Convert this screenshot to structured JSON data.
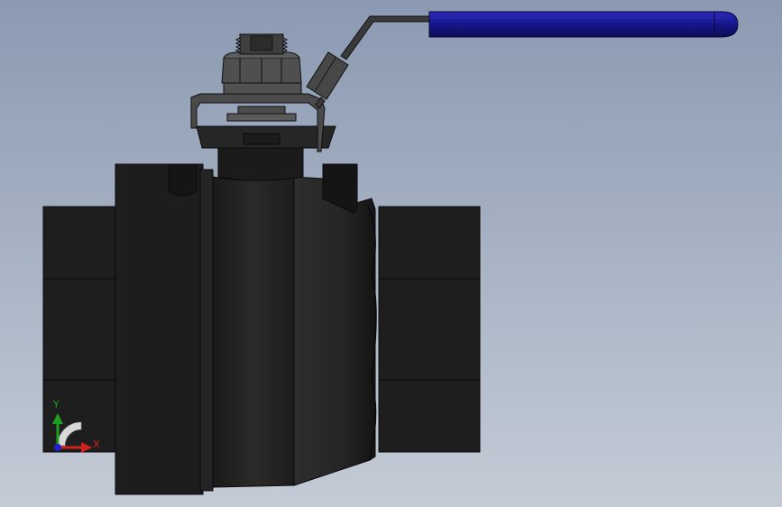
{
  "viewport": {
    "background_top": "#8b9ab2",
    "background_bottom": "#c4cbd6"
  },
  "model": {
    "body_color": "#1f1f1f",
    "steel_color": "#3c3c3c",
    "handle_grip_color": "#16168a"
  },
  "triad": {
    "x_label": "X",
    "y_label": "Y",
    "x_color": "#d02020",
    "y_color": "#20a020",
    "z_color": "#2020d0"
  }
}
